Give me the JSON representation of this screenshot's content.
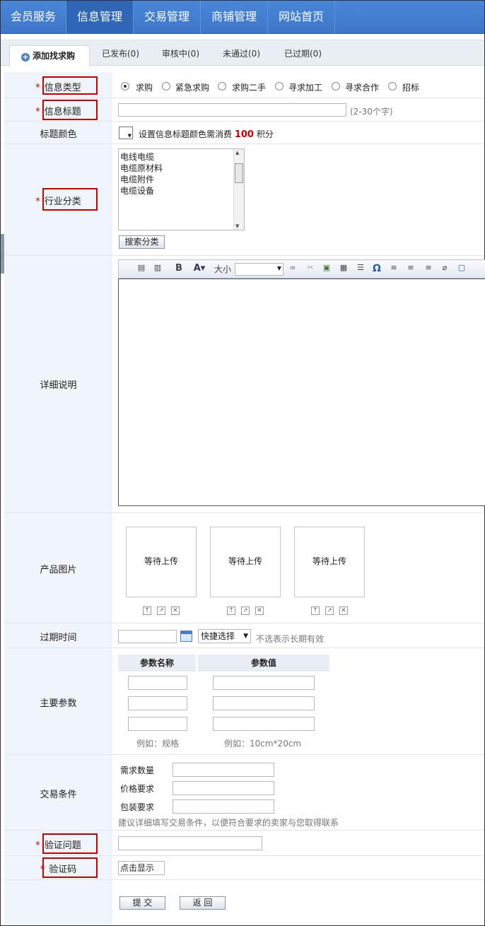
{
  "topnav": [
    "会员服务",
    "信息管理",
    "交易管理",
    "商铺管理",
    "网站首页"
  ],
  "subtabs": {
    "add": "添加找求购",
    "published": "已发布(0)",
    "reviewing": "审核中(0)",
    "rejected": "未通过(0)",
    "expired": "已过期(0)"
  },
  "labels": {
    "info_type": "信息类型",
    "info_title": "信息标题",
    "title_color": "标题颜色",
    "industry": "行业分类",
    "detail": "详细说明",
    "images": "产品图片",
    "expire": "过期时间",
    "params": "主要参数",
    "trade": "交易条件",
    "verify_q": "验证问题",
    "captcha": "验证码"
  },
  "required_mark": "*",
  "info_types": [
    "求购",
    "紧急求购",
    "求购二手",
    "寻求加工",
    "寻求合作",
    "招标"
  ],
  "title_hint": "(2-30个字)",
  "color_note_prefix": "设置信息标题颜色需消费",
  "color_points": "100",
  "color_note_suffix": "积分",
  "industry_options": [
    "电线电缆",
    "电缆原材料",
    "电缆附件",
    "电缆设备"
  ],
  "search_category": "搜索分类",
  "editor": {
    "size_label": "大小",
    "bold": "B",
    "font_color": "A"
  },
  "upload_placeholder": "等待上传",
  "expire": {
    "quick": "快捷选择",
    "note": "不选表示长期有效"
  },
  "param_headers": [
    "参数名称",
    "参数值"
  ],
  "param_examples": [
    "例如：规格",
    "例如：10cm*20cm"
  ],
  "trade_fields": [
    "需求数量",
    "价格要求",
    "包装要求"
  ],
  "trade_note": "建议详细填写交易条件，以便符合要求的卖家与您取得联系",
  "captcha_show": "点击显示",
  "buttons": {
    "submit": "提 交",
    "back": "返 回"
  }
}
